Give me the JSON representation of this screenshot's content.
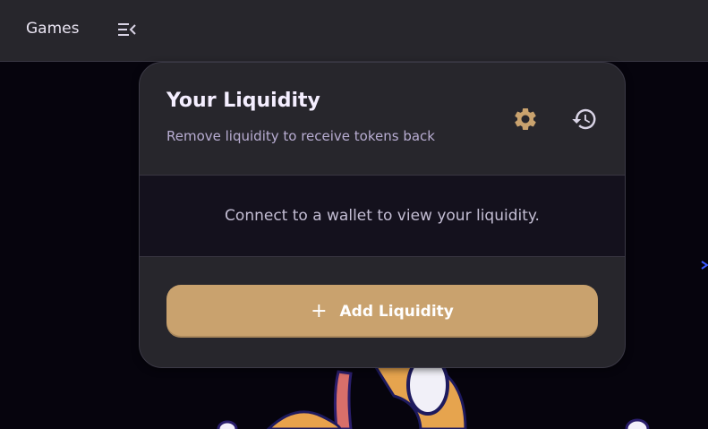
{
  "topbar": {
    "nav_label": "Games",
    "menu_icon": "menu-collapse-icon"
  },
  "card": {
    "title": "Your Liquidity",
    "subtitle": "Remove liquidity to receive tokens back",
    "settings_icon": "gear-icon",
    "history_icon": "history-icon",
    "empty_message": "Connect to a wallet to view your liquidity.",
    "add_button": {
      "icon": "plus-icon",
      "label": "Add Liquidity"
    }
  },
  "colors": {
    "accent": "#c9a26e",
    "topbar_bg": "#27262c",
    "card_bg": "#27262c",
    "card_body_bg": "#14111d",
    "page_bg": "#06040d"
  }
}
